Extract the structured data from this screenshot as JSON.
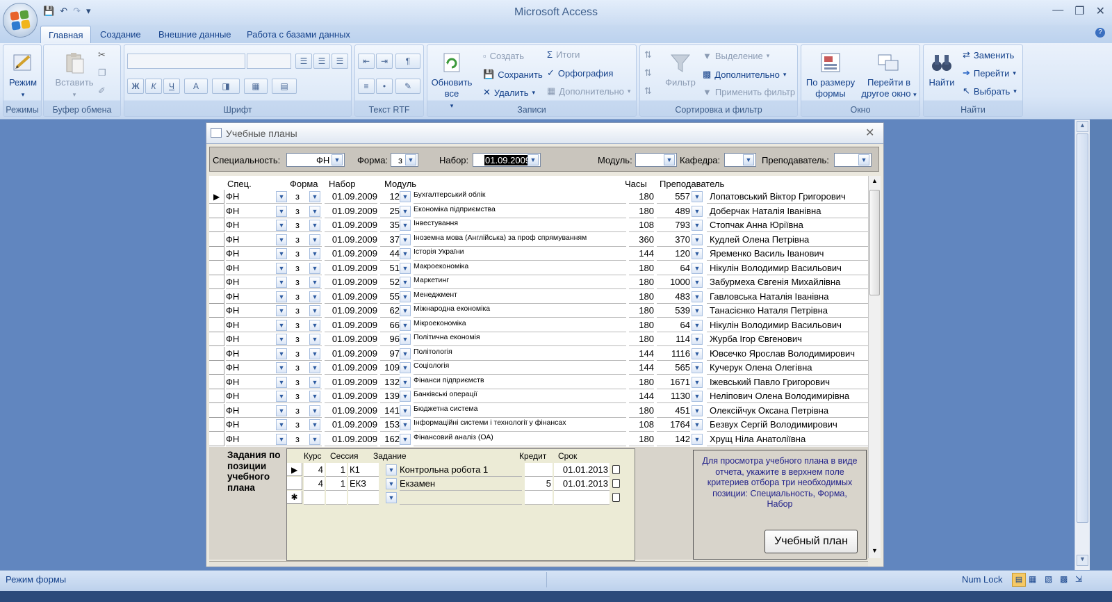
{
  "app": {
    "title": "Microsoft Access"
  },
  "tabs": [
    "Главная",
    "Создание",
    "Внешние данные",
    "Работа с базами данных"
  ],
  "ribbon": {
    "groups": [
      "Режимы",
      "Буфер обмена",
      "Шрифт",
      "Текст RTF",
      "Записи",
      "Сортировка и фильтр",
      "Окно",
      "Найти"
    ],
    "mode_label": "Режим",
    "paste_label": "Вставить",
    "refresh_label": "Обновить все",
    "records": {
      "create": "Создать",
      "save": "Сохранить",
      "delete": "Удалить",
      "totals": "Итоги",
      "spelling": "Орфография",
      "more": "Дополнительно"
    },
    "filter_label": "Фильтр",
    "sort": {
      "selection": "Выделение",
      "advanced": "Дополнительно",
      "apply": "Применить фильтр"
    },
    "window": {
      "fit": "По размеру формы",
      "switch": "Перейти в другое окно"
    },
    "find": {
      "find": "Найти",
      "replace": "Заменить",
      "goto": "Перейти",
      "select": "Выбрать"
    }
  },
  "form": {
    "title": "Учебные планы",
    "filters": {
      "spec_label": "Специальность:",
      "spec_value": "ФН",
      "form_label": "Форма:",
      "form_value": "з",
      "intake_label": "Набор:",
      "intake_value": "01.09.2009",
      "module_label": "Модуль:",
      "dept_label": "Кафедра:",
      "teacher_label": "Преподаватель:"
    },
    "columns": [
      "Спец.",
      "Форма",
      "Набор",
      "Модуль",
      "Часы",
      "Преподаватель"
    ],
    "rows": [
      {
        "spec": "ФН",
        "form": "з",
        "date": "01.09.2009",
        "mid": "12",
        "module": "Бухгалтерський облік",
        "hours": "180",
        "tid": "557",
        "teacher": "Лопатовський Віктор Григорович"
      },
      {
        "spec": "ФН",
        "form": "з",
        "date": "01.09.2009",
        "mid": "25",
        "module": "Економіка підприємства",
        "hours": "180",
        "tid": "489",
        "teacher": "Доберчак Наталія Іванівна"
      },
      {
        "spec": "ФН",
        "form": "з",
        "date": "01.09.2009",
        "mid": "35",
        "module": "Інвестування",
        "hours": "108",
        "tid": "793",
        "teacher": "Стопчак Анна Юріївна"
      },
      {
        "spec": "ФН",
        "form": "з",
        "date": "01.09.2009",
        "mid": "37",
        "module": "Іноземна мова (Англійська) за проф спрямуванням",
        "hours": "360",
        "tid": "370",
        "teacher": "Кудлей Олена Петрівна"
      },
      {
        "spec": "ФН",
        "form": "з",
        "date": "01.09.2009",
        "mid": "44",
        "module": "Історія України",
        "hours": "144",
        "tid": "120",
        "teacher": "Яременко Василь Іванович"
      },
      {
        "spec": "ФН",
        "form": "з",
        "date": "01.09.2009",
        "mid": "51",
        "module": "Макроекономіка",
        "hours": "180",
        "tid": "64",
        "teacher": "Нікулін Володимир Васильович"
      },
      {
        "spec": "ФН",
        "form": "з",
        "date": "01.09.2009",
        "mid": "52",
        "module": "Маркетинг",
        "hours": "180",
        "tid": "1000",
        "teacher": "Забурмеха Євгенія Михайлівна"
      },
      {
        "spec": "ФН",
        "form": "з",
        "date": "01.09.2009",
        "mid": "55",
        "module": "Менеджмент",
        "hours": "180",
        "tid": "483",
        "teacher": "Гавловська Наталія Іванівна"
      },
      {
        "spec": "ФН",
        "form": "з",
        "date": "01.09.2009",
        "mid": "62",
        "module": "Міжнародна економіка",
        "hours": "180",
        "tid": "539",
        "teacher": "Танасієнко Наталя Петрівна"
      },
      {
        "spec": "ФН",
        "form": "з",
        "date": "01.09.2009",
        "mid": "66",
        "module": "Мікроекономіка",
        "hours": "180",
        "tid": "64",
        "teacher": "Нікулін Володимир Васильович"
      },
      {
        "spec": "ФН",
        "form": "з",
        "date": "01.09.2009",
        "mid": "96",
        "module": "Політична економія",
        "hours": "180",
        "tid": "114",
        "teacher": "Журба Ігор Євгенович"
      },
      {
        "spec": "ФН",
        "form": "з",
        "date": "01.09.2009",
        "mid": "97",
        "module": "Політологія",
        "hours": "144",
        "tid": "1116",
        "teacher": "Ювсечко Ярослав Володимирович"
      },
      {
        "spec": "ФН",
        "form": "з",
        "date": "01.09.2009",
        "mid": "109",
        "module": "Соціологія",
        "hours": "144",
        "tid": "565",
        "teacher": "Кучерук Олена Олегівна"
      },
      {
        "spec": "ФН",
        "form": "з",
        "date": "01.09.2009",
        "mid": "132",
        "module": "Фінанси підприємств",
        "hours": "180",
        "tid": "1671",
        "teacher": "Іжевський Павло Григорович"
      },
      {
        "spec": "ФН",
        "form": "з",
        "date": "01.09.2009",
        "mid": "139",
        "module": "Банківські операції",
        "hours": "144",
        "tid": "1130",
        "teacher": "Неліпович Олена Володимирівна"
      },
      {
        "spec": "ФН",
        "form": "з",
        "date": "01.09.2009",
        "mid": "141",
        "module": "Бюджетна система",
        "hours": "180",
        "tid": "451",
        "teacher": "Олексійчук Оксана Петрівна"
      },
      {
        "spec": "ФН",
        "form": "з",
        "date": "01.09.2009",
        "mid": "153",
        "module": "Інформаційні системи і технології у фінансах",
        "hours": "108",
        "tid": "1764",
        "teacher": "Безвух Сергій Володимирович"
      },
      {
        "spec": "ФН",
        "form": "з",
        "date": "01.09.2009",
        "mid": "162",
        "module": "Фінансовий аналіз (ОА)",
        "hours": "180",
        "tid": "142",
        "teacher": "Хрущ Ніла Анатоліївна"
      }
    ],
    "sub_label": "Задания по позиции учебного плана",
    "sub_columns": [
      "Курс",
      "Сессия",
      "Задание",
      "Кредит",
      "Срок"
    ],
    "sub_rows": [
      {
        "course": "4",
        "session": "1",
        "code": "К1",
        "task": "Контрольна робота 1",
        "credit": "",
        "date": "01.01.2013"
      },
      {
        "course": "4",
        "session": "1",
        "code": "ЕКЗ",
        "task": "Екзамен",
        "credit": "5",
        "date": "01.01.2013"
      }
    ],
    "new_row_marker": "✱",
    "info_text": "Для просмотра учебного плана в виде отчета, укажите в верхнем поле критериев отбора три необходимых позиции: Специальность, Форма, Набор",
    "report_button": "Учебный план"
  },
  "status": {
    "left": "Режим формы",
    "numlock": "Num Lock"
  }
}
